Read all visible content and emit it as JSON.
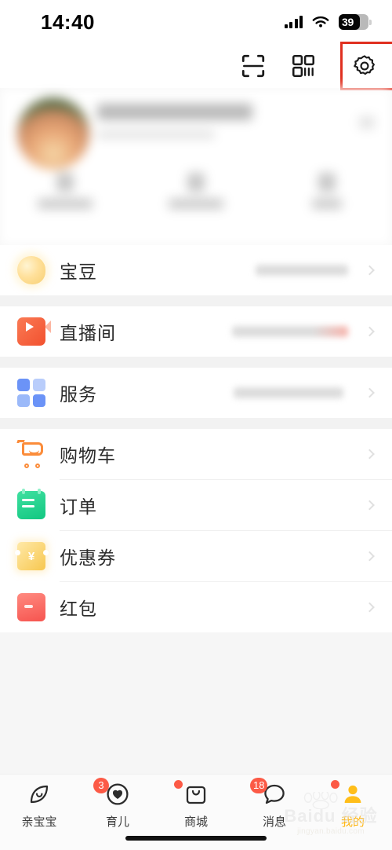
{
  "status_bar": {
    "time": "14:40",
    "battery_percent": "39",
    "signal_icon": "signal-bars-icon",
    "wifi_icon": "wifi-icon",
    "battery_icon": "battery-icon"
  },
  "header": {
    "scan_icon": "scan-icon",
    "qrcode_icon": "qrcode-icon",
    "settings_icon": "gear-icon",
    "highlight_color": "#e03020",
    "highlight_target": "gear-icon"
  },
  "profile": {
    "blurred": true,
    "avatar_icon": "avatar",
    "name": "",
    "subtitle": "",
    "stats": [
      {
        "value": "",
        "label": ""
      },
      {
        "value": "",
        "label": ""
      },
      {
        "value": "",
        "label": ""
      }
    ]
  },
  "menu": {
    "group_one": [
      {
        "label": "宝豆",
        "icon": "bean-icon",
        "color": "#f7cf72",
        "value": ""
      },
      {
        "label": "直播间",
        "icon": "live-video-icon",
        "color": "#f2512f",
        "value": ""
      },
      {
        "label": "服务",
        "icon": "grid-squares-icon",
        "color": "#6b93f7",
        "value": ""
      }
    ],
    "group_two": [
      {
        "label": "购物车",
        "icon": "shopping-cart-icon",
        "color": "#fb8c3a"
      },
      {
        "label": "订单",
        "icon": "order-clipboard-icon",
        "color": "#12c781"
      },
      {
        "label": "优惠券",
        "icon": "coupon-icon",
        "color": "#f7c74f",
        "symbol": "¥"
      },
      {
        "label": "红包",
        "icon": "red-packet-icon",
        "color": "#f6544f"
      }
    ]
  },
  "bottom_nav": {
    "active_color": "#ffb612",
    "badge_color": "#fc5a46",
    "tabs": [
      {
        "label": "亲宝宝",
        "icon": "leaf-face-icon",
        "badge": "",
        "dot": false,
        "active": false
      },
      {
        "label": "育儿",
        "icon": "heart-circle-icon",
        "badge": "3",
        "dot": false,
        "active": false
      },
      {
        "label": "商城",
        "icon": "shopping-bag-icon",
        "badge": "",
        "dot": true,
        "active": false
      },
      {
        "label": "消息",
        "icon": "chat-bubble-icon",
        "badge": "18",
        "dot": false,
        "active": false
      },
      {
        "label": "我的",
        "icon": "person-icon",
        "badge": "",
        "dot": true,
        "active": true
      }
    ]
  },
  "watermark": {
    "main": "Baidu 经验",
    "sub": "jingyan.baidu.com"
  }
}
